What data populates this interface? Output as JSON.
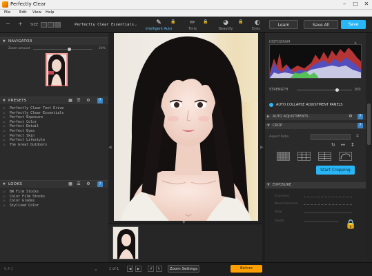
{
  "window": {
    "title": "Perfectly Clear",
    "controls": [
      "–",
      "□",
      "✕"
    ]
  },
  "menu": [
    "File",
    "Edit",
    "View",
    "Help"
  ],
  "toolbar": {
    "size_label": "SIZE",
    "preset_name": "Perfectly Clear Essentials",
    "tabs": [
      {
        "label": "Intelligent Auto",
        "icon": "pen-icon",
        "active": true
      },
      {
        "label": "Tints",
        "icon": "brush-icon",
        "active": false
      },
      {
        "label": "Beautify",
        "icon": "face-icon",
        "active": false
      },
      {
        "label": "Eyes",
        "icon": "eye-icon",
        "active": false
      }
    ],
    "learn": "Learn",
    "save_all": "Save All",
    "save": "Save",
    "accent": "#29b6f6"
  },
  "navigator": {
    "title": "NAVIGATOR",
    "zoom_label": "Zoom amount",
    "zoom_value": "29%",
    "zoom_fraction": 0.6
  },
  "presets": {
    "title": "PRESETS",
    "items": [
      "Perfectly Clear Text Drive",
      "Perfectly Clear Essentials",
      "Perfect Exposure",
      "Perfect Color",
      "Perfect Detail",
      "Perfect Eyes",
      "Perfect Skin",
      "Perfect Lifestyle",
      "The Great Outdoors"
    ]
  },
  "looks": {
    "title": "LOOKS",
    "items": [
      "BW Film Stocks",
      "Color Film Stocks",
      "Color Grades",
      "Stylized Color"
    ]
  },
  "histogram": {
    "title": "HISTOGRAM"
  },
  "strength": {
    "label": "STRENGTH",
    "value": "100",
    "fraction": 0.72
  },
  "auto_collapse": {
    "label": "AUTO COLLAPSE ADJUSTMENT PANELS",
    "on": true
  },
  "right_sections": {
    "s1": "AUTO ADJUSTMENTS",
    "s2": "CROP",
    "aspect_label": "Aspect Ratio",
    "start_cropping": "Start Cropping",
    "s3": "EXPOSURE",
    "row1": "Exposure",
    "row2": "Noise Removal",
    "row3": "Tone",
    "row4": "Depth"
  },
  "statusbar": {
    "filename": "0.4:1",
    "page": "1 of 1",
    "zoom_settings": "Zoom Settings",
    "before_after": "Before"
  }
}
